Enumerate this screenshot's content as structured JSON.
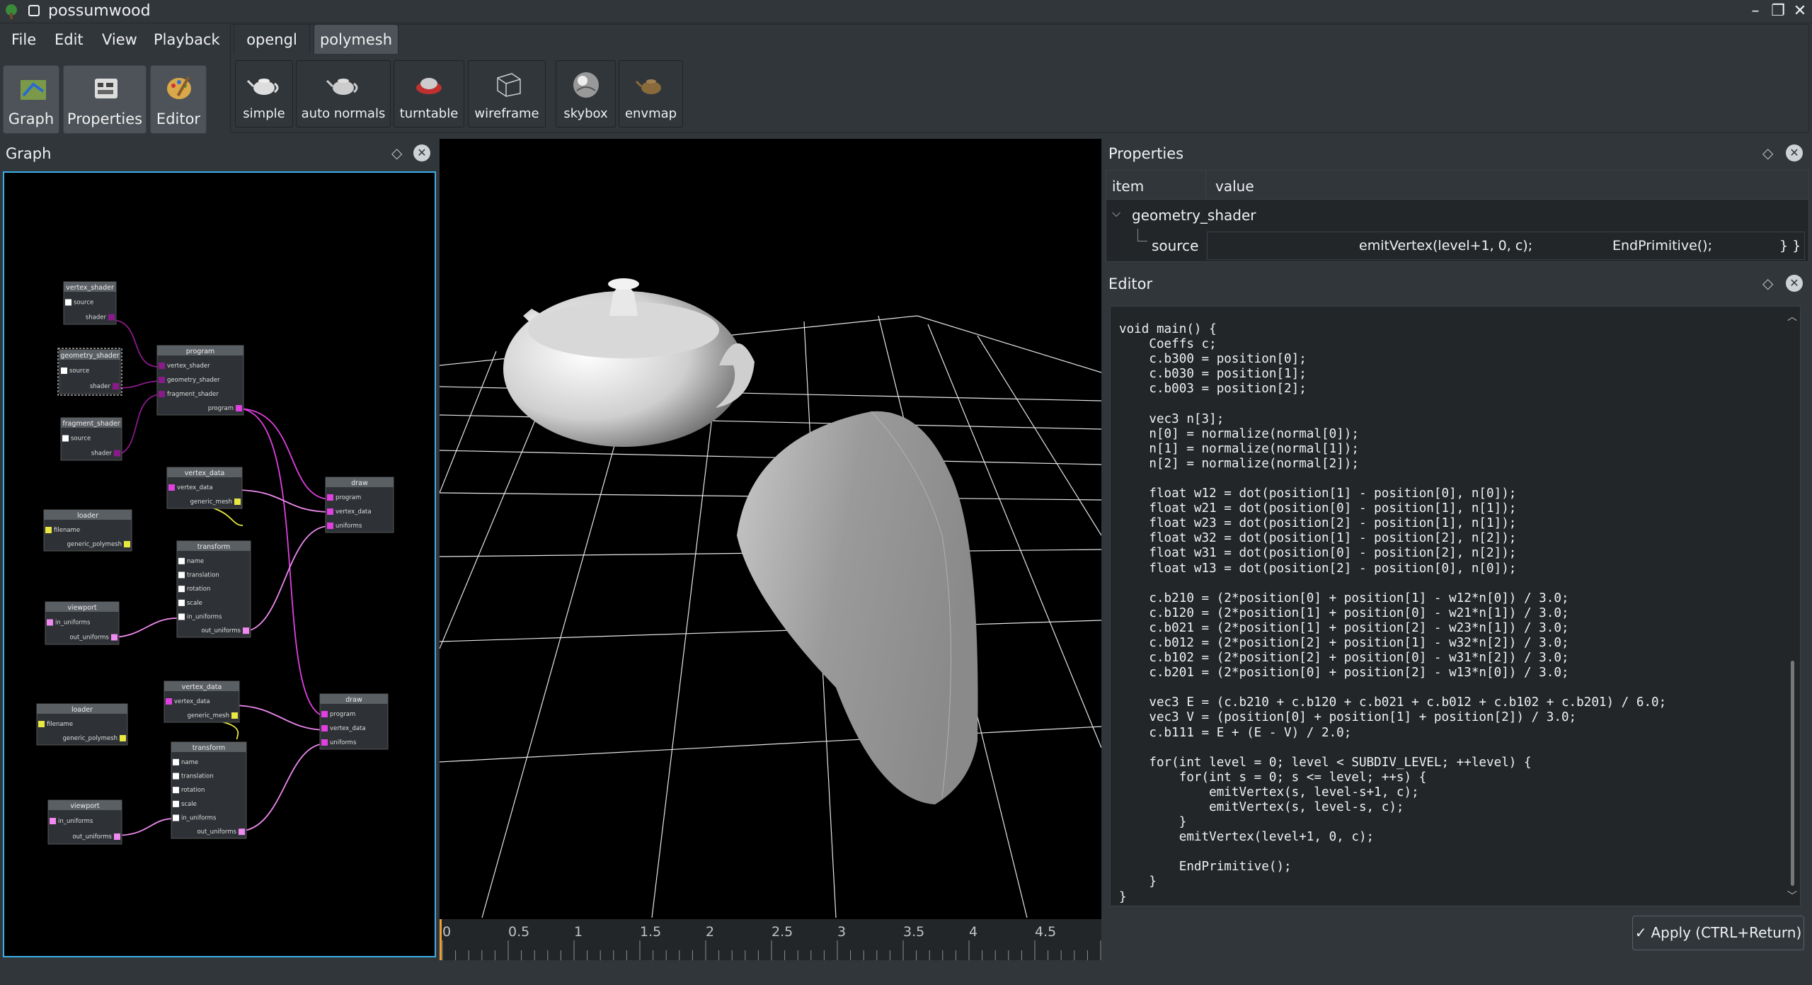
{
  "app": {
    "title": "possumwood",
    "window_controls": [
      "minimize",
      "maximize",
      "close"
    ]
  },
  "menu": [
    "File",
    "Edit",
    "View",
    "Playback"
  ],
  "modes": [
    {
      "label": "Graph",
      "icon": "graph-icon"
    },
    {
      "label": "Properties",
      "icon": "properties-icon"
    },
    {
      "label": "Editor",
      "icon": "editor-icon"
    }
  ],
  "tabs": [
    {
      "label": "opengl",
      "active": false
    },
    {
      "label": "polymesh",
      "active": true
    }
  ],
  "tools": [
    {
      "label": "simple"
    },
    {
      "label": "auto normals"
    },
    {
      "label": "turntable"
    },
    {
      "label": "wireframe"
    },
    {
      "label": "skybox"
    },
    {
      "label": "envmap"
    }
  ],
  "graph": {
    "title": "Graph",
    "nodes": {
      "vertex_shader": {
        "title": "vertex_shader",
        "ports": [
          "source",
          "shader"
        ]
      },
      "geometry_shader": {
        "title": "geometry_shader",
        "ports": [
          "source",
          "shader"
        ]
      },
      "fragment_shader": {
        "title": "fragment_shader",
        "ports": [
          "source",
          "shader"
        ]
      },
      "program": {
        "title": "program",
        "ports": [
          "vertex_shader",
          "geometry_shader",
          "fragment_shader",
          "program"
        ]
      },
      "vertex_data1": {
        "title": "vertex_data",
        "ports": [
          "vertex_data",
          "generic_mesh"
        ]
      },
      "loader1": {
        "title": "loader",
        "ports": [
          "filename",
          "generic_polymesh"
        ]
      },
      "transform1": {
        "title": "transform",
        "ports": [
          "name",
          "translation",
          "rotation",
          "scale",
          "in_uniforms",
          "out_uniforms"
        ]
      },
      "viewport1": {
        "title": "viewport",
        "ports": [
          "in_uniforms",
          "out_uniforms"
        ]
      },
      "draw1": {
        "title": "draw",
        "ports": [
          "program",
          "vertex_data",
          "uniforms"
        ]
      },
      "vertex_data2": {
        "title": "vertex_data",
        "ports": [
          "vertex_data",
          "generic_mesh"
        ]
      },
      "loader2": {
        "title": "loader",
        "ports": [
          "filename",
          "generic_polymesh"
        ]
      },
      "transform2": {
        "title": "transform",
        "ports": [
          "name",
          "translation",
          "rotation",
          "scale",
          "in_uniforms",
          "out_uniforms"
        ]
      },
      "viewport2": {
        "title": "viewport",
        "ports": [
          "in_uniforms",
          "out_uniforms"
        ]
      },
      "draw2": {
        "title": "draw",
        "ports": [
          "program",
          "vertex_data",
          "uniforms"
        ]
      }
    }
  },
  "timeline": {
    "ticks": [
      "0",
      "0.5",
      "1",
      "1.5",
      "2",
      "2.5",
      "3",
      "3.5",
      "4",
      "4.5"
    ]
  },
  "properties": {
    "title": "Properties",
    "col_item": "item",
    "col_value": "value",
    "group": "geometry_shader",
    "row_label": "source",
    "row_value": "emitVertex(level+1, 0, c);",
    "row_value2": "EndPrimitive();",
    "row_value3": "} }"
  },
  "editor": {
    "title": "Editor",
    "code": "void main() {\n    Coeffs c;\n    c.b300 = position[0];\n    c.b030 = position[1];\n    c.b003 = position[2];\n\n    vec3 n[3];\n    n[0] = normalize(normal[0]);\n    n[1] = normalize(normal[1]);\n    n[2] = normalize(normal[2]);\n\n    float w12 = dot(position[1] - position[0], n[0]);\n    float w21 = dot(position[0] - position[1], n[1]);\n    float w23 = dot(position[2] - position[1], n[1]);\n    float w32 = dot(position[1] - position[2], n[2]);\n    float w31 = dot(position[0] - position[2], n[2]);\n    float w13 = dot(position[2] - position[0], n[0]);\n\n    c.b210 = (2*position[0] + position[1] - w12*n[0]) / 3.0;\n    c.b120 = (2*position[1] + position[0] - w21*n[1]) / 3.0;\n    c.b021 = (2*position[1] + position[2] - w23*n[1]) / 3.0;\n    c.b012 = (2*position[2] + position[1] - w32*n[2]) / 3.0;\n    c.b102 = (2*position[2] + position[0] - w31*n[2]) / 3.0;\n    c.b201 = (2*position[0] + position[2] - w13*n[0]) / 3.0;\n\n    vec3 E = (c.b210 + c.b120 + c.b021 + c.b012 + c.b102 + c.b201) / 6.0;\n    vec3 V = (position[0] + position[1] + position[2]) / 3.0;\n    c.b111 = E + (E - V) / 2.0;\n\n    for(int level = 0; level < SUBDIV_LEVEL; ++level) {\n        for(int s = 0; s <= level; ++s) {\n            emitVertex(s, level-s+1, c);\n            emitVertex(s, level-s, c);\n        }\n        emitVertex(level+1, 0, c);\n\n        EndPrimitive();\n    }\n}",
    "apply_label": "Apply (CTRL+Return)"
  }
}
